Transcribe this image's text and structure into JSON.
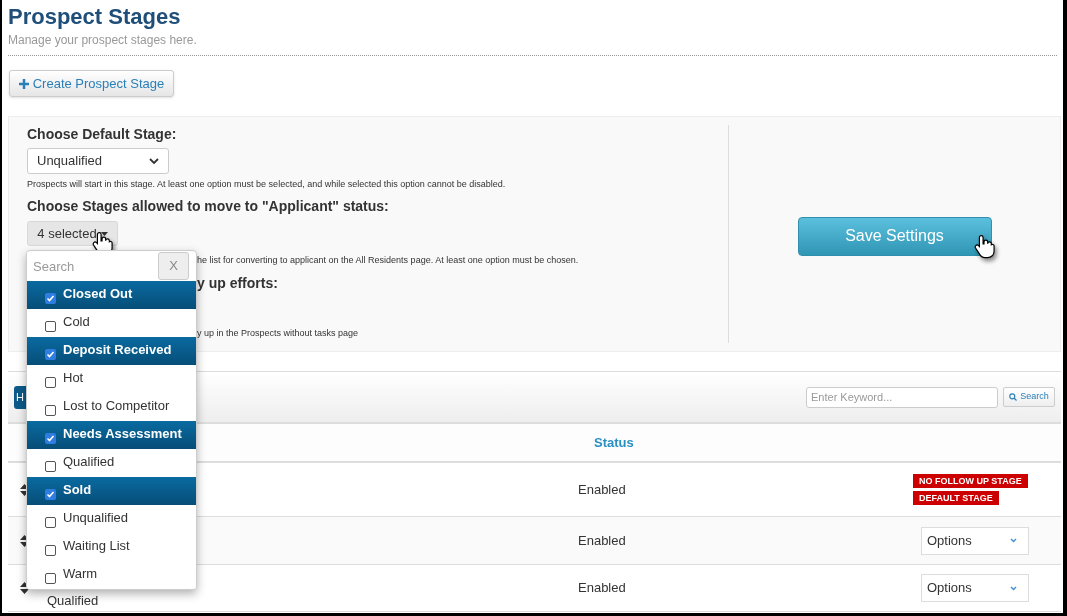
{
  "page": {
    "title": "Prospect Stages",
    "subtitle": "Manage your prospect stages here."
  },
  "create_button": {
    "label": "Create Prospect Stage"
  },
  "settings": {
    "default_stage_label": "Choose Default Stage:",
    "default_stage_value": "Unqualified",
    "default_stage_help": "Prospects will start in this stage. At least one option must be selected, and while selected this option cannot be disabled.",
    "applicant_label": "Choose Stages allowed to move to \"Applicant\" status:",
    "applicant_button": "4 selected",
    "applicant_help_fragment": "he list for converting to applicant on the All Residents page. At least one option must be chosen.",
    "followup_label_fragment": "y up efforts:",
    "followup_help_fragment": "y up in the Prospects without tasks page",
    "save_button": "Save Settings"
  },
  "stage_dropdown": {
    "search_placeholder": "Search",
    "clear_button": "X",
    "options": [
      {
        "label": "Closed Out",
        "checked": true
      },
      {
        "label": "Cold",
        "checked": false
      },
      {
        "label": "Deposit Received",
        "checked": true
      },
      {
        "label": "Hot",
        "checked": false
      },
      {
        "label": "Lost to Competitor",
        "checked": false
      },
      {
        "label": "Needs Assessment",
        "checked": true
      },
      {
        "label": "Qualified",
        "checked": false
      },
      {
        "label": "Sold",
        "checked": true
      },
      {
        "label": "Unqualified",
        "checked": false
      },
      {
        "label": "Waiting List",
        "checked": false
      },
      {
        "label": "Warm",
        "checked": false
      }
    ]
  },
  "toolbar": {
    "button_fragment": "H",
    "keyword_placeholder": "Enter Keyword...",
    "search_button": "Search"
  },
  "table": {
    "columns": [
      "Status"
    ],
    "rows": [
      {
        "status": "Enabled",
        "badges": [
          "NO FOLLOW UP STAGE",
          "DEFAULT STAGE"
        ]
      },
      {
        "status": "Enabled",
        "action": "Options"
      },
      {
        "name": "Qualified",
        "status": "Enabled",
        "action": "Options"
      }
    ]
  }
}
